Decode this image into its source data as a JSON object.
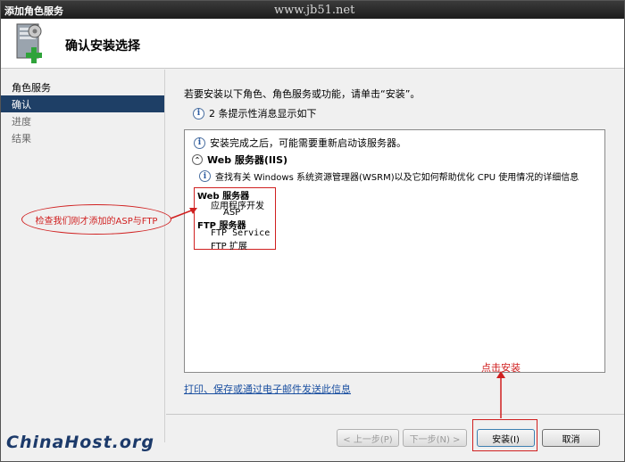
{
  "window": {
    "title": "添加角色服务",
    "watermark": "www.jb51.net"
  },
  "header": {
    "icon": "server-add-icon",
    "page_title": "确认安装选择"
  },
  "sidebar": {
    "items": [
      {
        "label": "角色服务",
        "state": "normal"
      },
      {
        "label": "确认",
        "state": "active"
      },
      {
        "label": "进度",
        "state": "disabled"
      },
      {
        "label": "结果",
        "state": "disabled"
      }
    ]
  },
  "main": {
    "intro": "若要安装以下角色、角色服务或功能，请单击“安装”。",
    "note_count": "2 条提示性消息显示如下",
    "summary": {
      "restart_note": "安装完成之后，可能需要重新启动该服务器。",
      "web_heading": "Web 服务器(IIS)",
      "wsrm_note": "查找有关 Windows 系统资源管理器(WSRM)以及它如何帮助优化 CPU 使用情况的详细信息",
      "tree": {
        "web_server": "Web 服务器",
        "app_dev": "应用程序开发",
        "asp": "ASP",
        "ftp_server": "FTP 服务器",
        "ftp_service": "FTP Service",
        "ftp_ext": "FTP 扩展"
      }
    },
    "print_link": "打印、保存或通过电子邮件发送此信息"
  },
  "buttons": {
    "prev": "< 上一步(P)",
    "next": "下一步(N) >",
    "install": "安装(I)",
    "cancel": "取消"
  },
  "annotations": {
    "install_hint": "点击安装",
    "check_hint": "检查我们刚才添加的ASP与FTP",
    "color": "#d02020"
  },
  "brand": "ChinaHost.org"
}
